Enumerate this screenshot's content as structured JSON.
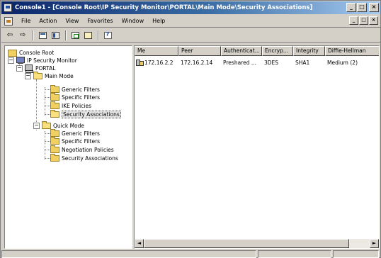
{
  "window": {
    "title": "Console1 - [Console Root\\IP Security Monitor\\PORTAL\\Main Mode\\Security Associations]",
    "minimize": "_",
    "maximize": "□",
    "close": "×"
  },
  "menu": {
    "items": [
      "File",
      "Action",
      "View",
      "Favorites",
      "Window",
      "Help"
    ],
    "child_min": "_",
    "child_max": "□",
    "child_close": "×"
  },
  "toolbar": {
    "back": "⇦",
    "forward": "⇨"
  },
  "tree": {
    "console_root": "Console Root",
    "ip_monitor": "IP Security Monitor",
    "portal": "PORTAL",
    "main_mode": "Main Mode",
    "mm_generic": "Generic Filters",
    "mm_specific": "Specific Filters",
    "mm_ike": "IKE Policies",
    "mm_sa": "Security Associations",
    "quick_mode": "Quick Mode",
    "qm_generic": "Generic Filters",
    "qm_specific": "Specific Filters",
    "qm_negotiation": "Negotiation Policies",
    "qm_sa": "Security Associations",
    "minus": "−"
  },
  "list": {
    "columns": [
      "Me",
      "Peer",
      "Authenticat...",
      "Encryp...",
      "Integrity",
      "Diffie-Hellman"
    ],
    "rows": [
      [
        "172.16.2.2",
        "172.16.2.14",
        "Preshared ...",
        "3DES",
        "SHA1",
        "Medium (2)"
      ]
    ]
  },
  "scrollbar": {
    "left": "◄",
    "right": "►"
  }
}
